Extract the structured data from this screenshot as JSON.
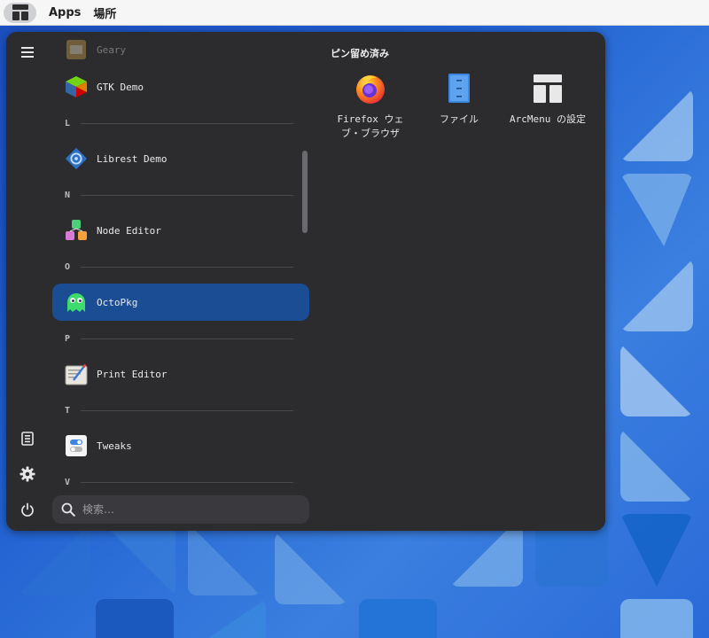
{
  "topbar": {
    "apps_label": "Apps",
    "places_label": "場所"
  },
  "menu": {
    "pinned_title": "ピン留め済み",
    "search_placeholder": "検索…",
    "selected_color": "#1a4d94",
    "app_list": [
      {
        "type": "app",
        "label": "Geary",
        "icon": "geary-icon",
        "faded": true
      },
      {
        "type": "app",
        "label": "GTK Demo",
        "icon": "gtk-demo-icon"
      },
      {
        "type": "header",
        "letter": "L"
      },
      {
        "type": "app",
        "label": "Librest Demo",
        "icon": "librest-demo-icon"
      },
      {
        "type": "header",
        "letter": "N"
      },
      {
        "type": "app",
        "label": "Node Editor",
        "icon": "node-editor-icon"
      },
      {
        "type": "header",
        "letter": "O"
      },
      {
        "type": "app",
        "label": "OctoPkg",
        "icon": "octopkg-icon",
        "selected": true
      },
      {
        "type": "header",
        "letter": "P"
      },
      {
        "type": "app",
        "label": "Print Editor",
        "icon": "print-editor-icon"
      },
      {
        "type": "header",
        "letter": "T"
      },
      {
        "type": "app",
        "label": "Tweaks",
        "icon": "tweaks-icon"
      },
      {
        "type": "header",
        "letter": "V"
      }
    ],
    "pinned": [
      {
        "label": "Firefox ウェブ・ブラウザ",
        "icon": "firefox-icon"
      },
      {
        "label": "ファイル",
        "icon": "files-icon"
      },
      {
        "label": "ArcMenu の設定",
        "icon": "arcmenu-settings-icon"
      }
    ]
  }
}
